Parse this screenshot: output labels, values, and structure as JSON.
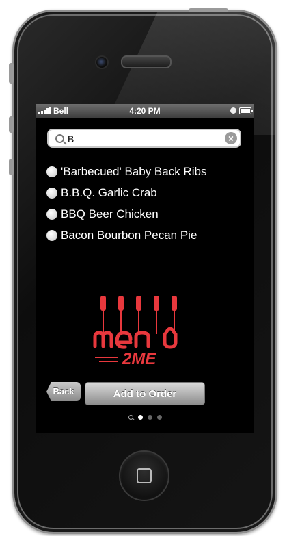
{
  "status_bar": {
    "carrier": "Bell",
    "time": "4:20 PM",
    "clock_icon": "clock-icon",
    "battery_icon": "battery-icon",
    "signal_icon": "signal-bars-icon"
  },
  "search": {
    "value": "B",
    "placeholder": "",
    "search_icon": "search-icon",
    "clear_icon": "clear-icon"
  },
  "results": [
    {
      "label": "'Barbecued' Baby Back Ribs"
    },
    {
      "label": "B.B.Q. Garlic Crab"
    },
    {
      "label": "BBQ Beer Chicken"
    },
    {
      "label": "Bacon Bourbon Pecan Pie"
    }
  ],
  "logo": {
    "word": "menu",
    "tagline": "2ME",
    "color": "#e8383d"
  },
  "actions": {
    "back_label": "Back",
    "add_label": "Add to Order"
  },
  "pager": {
    "total_pages": 3,
    "current_page": 1
  },
  "colors": {
    "screen_bg": "#000000",
    "accent": "#e8383d",
    "button_gray": "#9a9a9a"
  }
}
